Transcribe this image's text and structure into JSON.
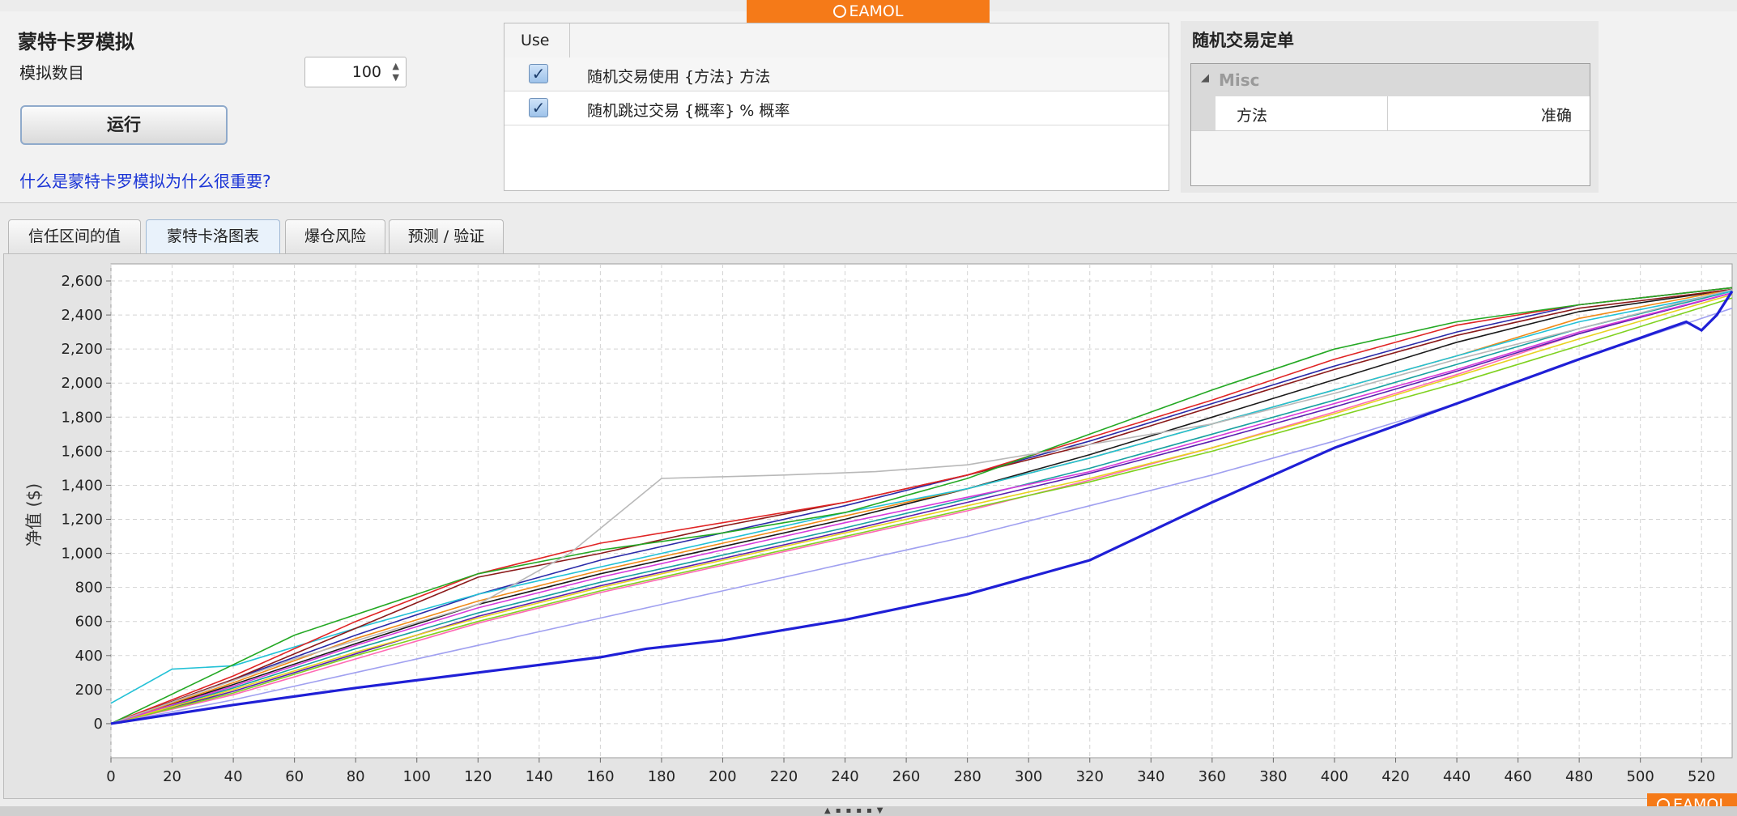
{
  "header": {
    "logo": "EAMOL"
  },
  "monte_carlo": {
    "title": "蒙特卡罗模拟",
    "count_label": "模拟数目",
    "count_value": "100",
    "run_label": "运行",
    "help_link": "什么是蒙特卡罗模拟为什么很重要?"
  },
  "options_table": {
    "column": "Use",
    "rows": [
      {
        "checked": true,
        "label": "随机交易使用 {方法} 方法"
      },
      {
        "checked": true,
        "label": "随机跳过交易 {概率} % 概率"
      }
    ]
  },
  "property_grid": {
    "title": "随机交易定单",
    "category": "Misc",
    "rows": [
      {
        "key": "方法",
        "value": "准确"
      }
    ]
  },
  "tabs": [
    {
      "label": "信任区间的值",
      "active": false
    },
    {
      "label": "蒙特卡洛图表",
      "active": true
    },
    {
      "label": "爆仓风险",
      "active": false
    },
    {
      "label": "预测 / 验证",
      "active": false
    }
  ],
  "footer": {
    "logo": "EAMOL"
  },
  "chart_data": {
    "type": "line",
    "title": "",
    "xlabel": "",
    "ylabel": "净值 ($)",
    "xlim": [
      0,
      530
    ],
    "ylim": [
      -200,
      2700
    ],
    "x_ticks": [
      0,
      20,
      40,
      60,
      80,
      100,
      120,
      140,
      160,
      180,
      200,
      220,
      240,
      260,
      280,
      300,
      320,
      340,
      360,
      380,
      400,
      420,
      440,
      460,
      480,
      500,
      520
    ],
    "y_ticks": [
      0,
      200,
      400,
      600,
      800,
      1000,
      1200,
      1400,
      1600,
      1800,
      2000,
      2200,
      2400,
      2600
    ],
    "grid": true,
    "legend": "none",
    "note": "about 100 overlapping multicolored equity paths from 0 to about 2550",
    "series": [
      {
        "color": "#1f1fd6",
        "bold": true,
        "x": [
          0,
          40,
          80,
          120,
          160,
          175,
          200,
          240,
          280,
          320,
          360,
          400,
          440,
          480,
          515,
          520,
          525,
          530
        ],
        "y": [
          0,
          110,
          210,
          300,
          390,
          440,
          490,
          610,
          760,
          960,
          1300,
          1620,
          1880,
          2140,
          2360,
          2310,
          2400,
          2540
        ]
      },
      {
        "color": "#b8b8b8",
        "x": [
          0,
          60,
          120,
          150,
          180,
          200,
          220,
          250,
          280,
          320,
          360,
          400,
          440,
          480,
          530
        ],
        "y": [
          0,
          380,
          700,
          1000,
          1440,
          1450,
          1460,
          1480,
          1520,
          1640,
          1760,
          1940,
          2140,
          2320,
          2550
        ]
      },
      {
        "color": "#23a823",
        "x": [
          0,
          60,
          120,
          160,
          200,
          240,
          280,
          320,
          360,
          400,
          440,
          480,
          530
        ],
        "y": [
          0,
          520,
          880,
          1020,
          1120,
          1240,
          1440,
          1700,
          1960,
          2200,
          2360,
          2460,
          2560
        ]
      },
      {
        "color": "#e02424",
        "x": [
          0,
          40,
          80,
          120,
          160,
          200,
          240,
          280,
          320,
          360,
          400,
          440,
          480,
          530
        ],
        "y": [
          0,
          280,
          600,
          880,
          1060,
          1180,
          1300,
          1460,
          1680,
          1900,
          2140,
          2340,
          2460,
          2560
        ]
      },
      {
        "color": "#8b1a1a",
        "x": [
          0,
          40,
          80,
          120,
          160,
          200,
          240,
          280,
          320,
          360,
          400,
          440,
          480,
          530
        ],
        "y": [
          0,
          260,
          560,
          860,
          1000,
          1160,
          1300,
          1460,
          1640,
          1860,
          2080,
          2280,
          2440,
          2550
        ]
      },
      {
        "color": "#22c1d6",
        "x": [
          0,
          20,
          40,
          80,
          120,
          160,
          200,
          240,
          280,
          320,
          360,
          400,
          440,
          480,
          530
        ],
        "y": [
          120,
          320,
          340,
          560,
          760,
          920,
          1080,
          1240,
          1380,
          1560,
          1760,
          1960,
          2160,
          2360,
          2540
        ]
      },
      {
        "color": "#d63adb",
        "x": [
          0,
          40,
          80,
          120,
          160,
          200,
          240,
          280,
          320,
          360,
          400,
          440,
          480,
          530
        ],
        "y": [
          0,
          220,
          460,
          680,
          860,
          1020,
          1180,
          1330,
          1480,
          1680,
          1880,
          2080,
          2300,
          2530
        ]
      },
      {
        "color": "#e8d21f",
        "x": [
          0,
          40,
          80,
          120,
          160,
          200,
          240,
          280,
          320,
          360,
          400,
          440,
          480,
          530
        ],
        "y": [
          0,
          200,
          420,
          620,
          800,
          960,
          1120,
          1280,
          1440,
          1620,
          1820,
          2040,
          2260,
          2520
        ]
      },
      {
        "color": "#f08a18",
        "x": [
          0,
          40,
          80,
          120,
          160,
          200,
          240,
          280,
          320,
          360,
          400,
          440,
          480,
          530
        ],
        "y": [
          0,
          240,
          500,
          720,
          900,
          1060,
          1220,
          1380,
          1560,
          1760,
          1960,
          2160,
          2380,
          2550
        ]
      },
      {
        "color": "#7fd11f",
        "x": [
          0,
          40,
          80,
          120,
          160,
          200,
          240,
          280,
          320,
          360,
          400,
          440,
          480,
          530
        ],
        "y": [
          0,
          180,
          400,
          600,
          780,
          940,
          1100,
          1260,
          1420,
          1600,
          1800,
          2000,
          2220,
          2500
        ]
      },
      {
        "color": "#2a2aa8",
        "x": [
          0,
          40,
          80,
          120,
          160,
          200,
          240,
          280,
          320,
          360,
          400,
          440,
          480,
          530
        ],
        "y": [
          0,
          260,
          520,
          760,
          960,
          1120,
          1280,
          1460,
          1660,
          1880,
          2100,
          2300,
          2460,
          2560
        ]
      },
      {
        "color": "#a0a0f0",
        "x": [
          0,
          40,
          80,
          120,
          160,
          200,
          240,
          280,
          320,
          360,
          400,
          440,
          480,
          530
        ],
        "y": [
          0,
          140,
          300,
          460,
          620,
          780,
          940,
          1100,
          1280,
          1460,
          1660,
          1880,
          2140,
          2440
        ]
      },
      {
        "color": "#18a0a0",
        "x": [
          0,
          40,
          80,
          120,
          160,
          200,
          240,
          280,
          320,
          360,
          400,
          440,
          480,
          530
        ],
        "y": [
          0,
          210,
          440,
          650,
          830,
          990,
          1150,
          1320,
          1500,
          1700,
          1900,
          2110,
          2320,
          2540
        ]
      },
      {
        "color": "#5a1fb0",
        "x": [
          0,
          40,
          80,
          120,
          160,
          200,
          240,
          280,
          320,
          360,
          400,
          440,
          480,
          530
        ],
        "y": [
          0,
          190,
          410,
          630,
          810,
          970,
          1130,
          1300,
          1470,
          1660,
          1860,
          2070,
          2290,
          2530
        ]
      },
      {
        "color": "#1a1a1a",
        "x": [
          0,
          40,
          80,
          120,
          160,
          200,
          240,
          280,
          320,
          360,
          400,
          440,
          480,
          530
        ],
        "y": [
          0,
          230,
          470,
          700,
          880,
          1040,
          1200,
          1380,
          1580,
          1800,
          2020,
          2240,
          2420,
          2550
        ]
      },
      {
        "color": "#ff69b4",
        "x": [
          0,
          40,
          80,
          120,
          160,
          200,
          240,
          280,
          320,
          360,
          400,
          440,
          480,
          530
        ],
        "y": [
          0,
          170,
          380,
          590,
          770,
          930,
          1090,
          1250,
          1430,
          1620,
          1830,
          2050,
          2290,
          2530
        ]
      }
    ]
  }
}
